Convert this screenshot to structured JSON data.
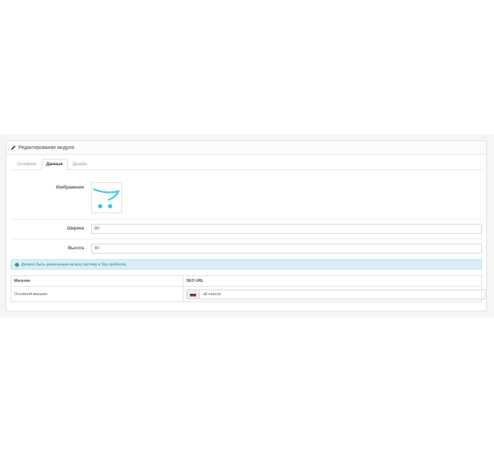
{
  "panel": {
    "title": "Редактирование модуля",
    "title_icon": "pencil-icon"
  },
  "tabs": [
    {
      "label": "Основное",
      "active": false
    },
    {
      "label": "Данные",
      "active": true
    },
    {
      "label": "Дизайн",
      "active": false
    }
  ],
  "form": {
    "image_label": "Изображение",
    "image_icon": "cart-icon",
    "width_label": "Ширина",
    "width_value": "80",
    "height_label": "Высота",
    "height_value": "80"
  },
  "alert": {
    "icon": "info-icon",
    "text": "Должно быть уникальным на всю систему и без пробелов."
  },
  "table": {
    "headers": [
      "Магазин",
      "SEO URL"
    ],
    "rows": [
      {
        "store": "Основной магазин",
        "seo_value": "all-roducts",
        "flag_icon": "russia-flag-icon"
      }
    ]
  },
  "colors": {
    "accent": "#34c4e8",
    "alert_bg": "#d9edf7",
    "alert_text": "#31708f"
  }
}
